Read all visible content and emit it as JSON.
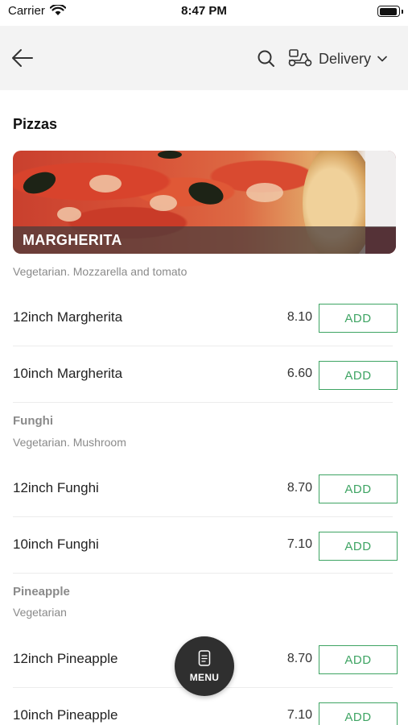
{
  "status_bar": {
    "carrier": "Carrier",
    "time": "8:47 PM",
    "battery_level": 0.95
  },
  "nav": {
    "delivery_label": "Delivery"
  },
  "section": {
    "title": "Pizzas",
    "hero_caption": "MARGHERITA",
    "hero_description": "Vegetarian. Mozzarella and tomato"
  },
  "groups": [
    {
      "title": "Funghi",
      "description": "Vegetarian. Mushroom"
    },
    {
      "title": "Pineapple",
      "description": "Vegetarian"
    }
  ],
  "items": [
    {
      "name": "12inch Margherita",
      "price": "8.10",
      "action": "ADD"
    },
    {
      "name": "10inch Margherita",
      "price": "6.60",
      "action": "ADD"
    },
    {
      "name": "12inch Funghi",
      "price": "8.70",
      "action": "ADD"
    },
    {
      "name": "10inch Funghi",
      "price": "7.10",
      "action": "ADD"
    },
    {
      "name": "12inch Pineapple",
      "price": "8.70",
      "action": "ADD"
    },
    {
      "name": "10inch Pineapple",
      "price": "7.10",
      "action": "ADD"
    }
  ],
  "fab": {
    "label": "MENU"
  },
  "colors": {
    "accent_green": "#3ea463",
    "nav_bg": "#f3f3f3",
    "fab_bg": "#2f2f2f"
  },
  "icons": [
    "wifi-icon",
    "battery-icon",
    "back-arrow-icon",
    "search-icon",
    "scooter-icon",
    "chevron-down-icon",
    "menu-card-icon"
  ]
}
